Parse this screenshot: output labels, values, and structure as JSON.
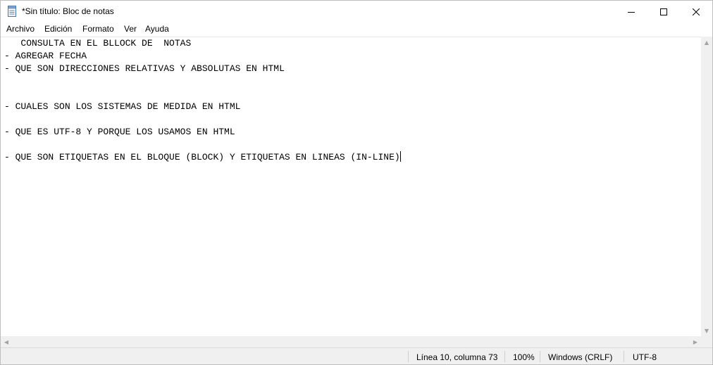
{
  "window": {
    "title": "*Sin título: Bloc de notas"
  },
  "menu": {
    "items": [
      {
        "label": "Archivo"
      },
      {
        "label": "Edición"
      },
      {
        "label": "Formato"
      },
      {
        "label": "Ver"
      },
      {
        "label": "Ayuda"
      }
    ]
  },
  "editor": {
    "text": "   CONSULTA EN EL BLLOCK DE  NOTAS\n- AGREGAR FECHA\n- QUE SON DIRECCIONES RELATIVAS Y ABSOLUTAS EN HTML\n\n\n- CUALES SON LOS SISTEMAS DE MEDIDA EN HTML\n\n- QUE ES UTF-8 Y PORQUE LOS USAMOS EN HTML\n\n- QUE SON ETIQUETAS EN EL BLOQUE (BLOCK) Y ETIQUETAS EN LINEAS (IN-LINE)"
  },
  "statusbar": {
    "position": "Línea 10, columna 73",
    "zoom": "100%",
    "line_ending": "Windows (CRLF)",
    "encoding": "UTF-8"
  },
  "icons": {
    "app": "notepad-icon",
    "minimize": "minimize-icon",
    "maximize": "maximize-icon",
    "close": "close-icon"
  }
}
